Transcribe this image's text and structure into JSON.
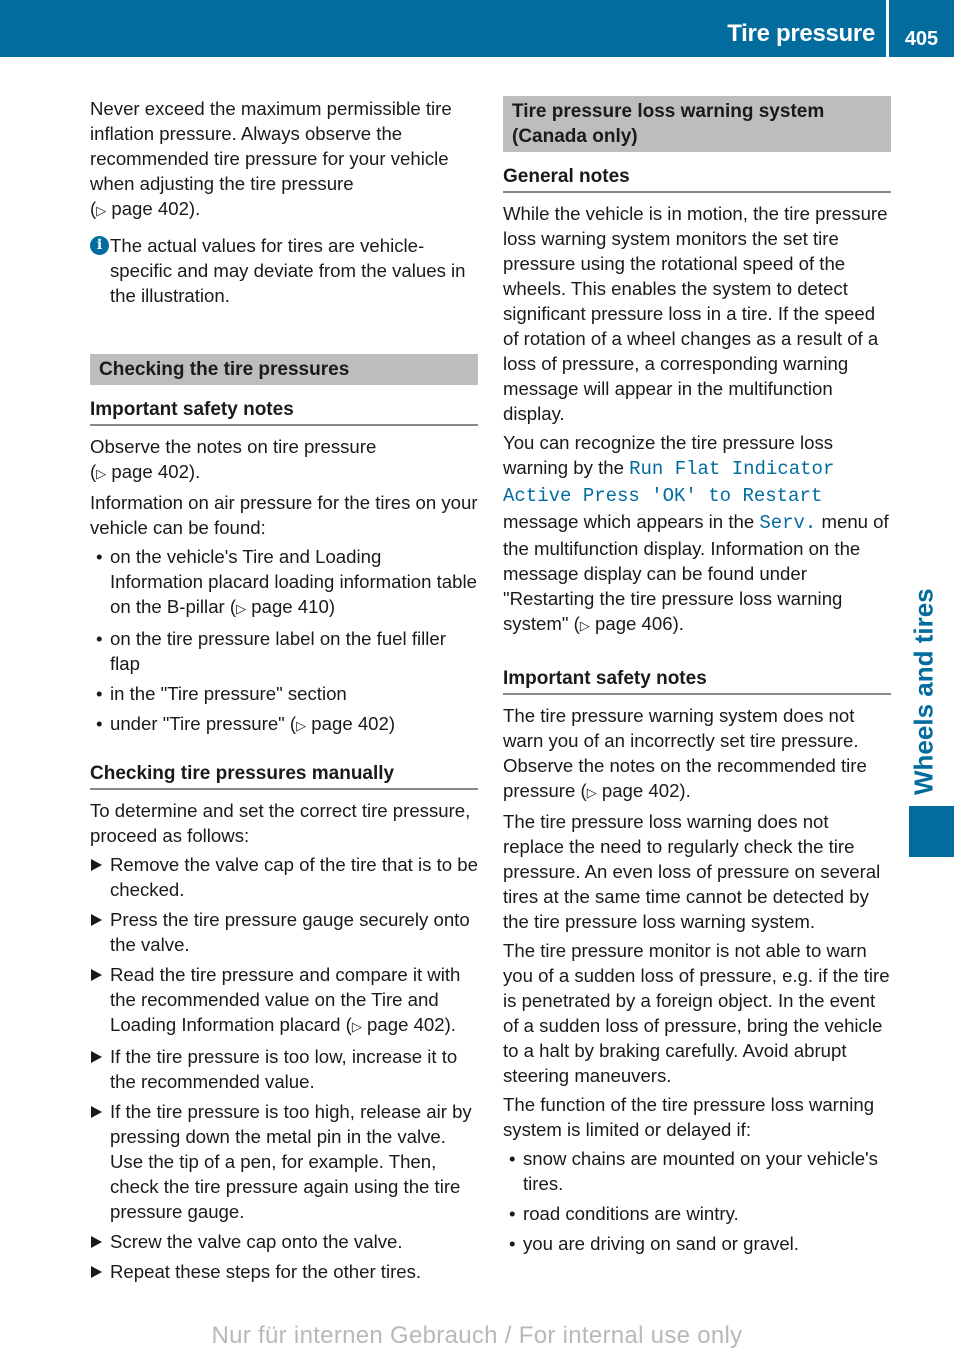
{
  "header": {
    "title": "Tire pressure",
    "page_number": "405"
  },
  "side_tab": {
    "label": "Wheels and tires"
  },
  "colors": {
    "accent": "#036c9f",
    "banner_gray": "#bdbdbd"
  },
  "left": {
    "intro": "Never exceed the maximum permissible tire inflation pressure. Always observe the recommended tire pressure for your vehicle when adjusting the tire pressure",
    "intro_ref": "page 402).",
    "info_note": "The actual values for tires are vehicle-specific and may deviate from the values in the illustration.",
    "section_title": "Checking the tire pressures",
    "safety_heading": "Important safety notes",
    "safety_p1": "Observe the notes on tire pressure",
    "safety_p1_ref": "page 402).",
    "safety_p2": "Information on air pressure for the tires on your vehicle can be found:",
    "locations": [
      {
        "text": "on the vehicle's Tire and Loading Information placard loading information table on the B-pillar (",
        "ref": "page 410)"
      },
      {
        "text": "on the tire pressure label on the fuel filler flap",
        "ref": ""
      },
      {
        "text": "in the \"Tire pressure\" section",
        "ref": ""
      },
      {
        "text": "under \"Tire pressure\" (",
        "ref": "page 402)"
      }
    ],
    "manual_heading": "Checking tire pressures manually",
    "manual_intro": "To determine and set the correct tire pressure, proceed as follows:",
    "steps": [
      {
        "text": "Remove the valve cap of the tire that is to be checked.",
        "ref": ""
      },
      {
        "text": "Press the tire pressure gauge securely onto the valve.",
        "ref": ""
      },
      {
        "text": "Read the tire pressure and compare it with the recommended value on the Tire and Loading Information placard (",
        "ref": "page 402)."
      },
      {
        "text": "If the tire pressure is too low, increase it to the recommended value.",
        "ref": ""
      },
      {
        "text": "If the tire pressure is too high, release air by pressing down the metal pin in the valve. Use the tip of a pen, for example. Then, check the tire pressure again using the tire pressure gauge.",
        "ref": ""
      },
      {
        "text": "Screw the valve cap onto the valve.",
        "ref": ""
      },
      {
        "text": "Repeat these steps for the other tires.",
        "ref": ""
      }
    ]
  },
  "right": {
    "section_title": "Tire pressure loss warning system (Canada only)",
    "general_heading": "General notes",
    "general_p1": "While the vehicle is in motion, the tire pressure loss warning system monitors the set tire pressure using the rotational speed of the wheels. This enables the system to detect significant pressure loss in a tire. If the speed of rotation of a wheel changes as a result of a loss of pressure, a corresponding warning message will appear in the multifunction display.",
    "general_p2_a": "You can recognize the tire pressure loss warning by the ",
    "display_message": "Run Flat Indicator Active Press 'OK' to Restart",
    "general_p2_b": " message which appears in the ",
    "menu_name": "Serv.",
    "general_p2_c": " menu of the multifunction display. Information on the message display can be found under \"Restarting the tire pressure loss warning system\" (",
    "general_p2_ref": "page 406).",
    "safety_heading": "Important safety notes",
    "safety_p1": "The tire pressure warning system does not warn you of an incorrectly set tire pressure. Observe the notes on the recommended tire pressure (",
    "safety_p1_ref": "page 402).",
    "safety_p2": "The tire pressure loss warning does not replace the need to regularly check the tire pressure. An even loss of pressure on several tires at the same time cannot be detected by the tire pressure loss warning system.",
    "safety_p3": "The tire pressure monitor is not able to warn you of a sudden loss of pressure, e.g. if the tire is penetrated by a foreign object. In the event of a sudden loss of pressure, bring the vehicle to a halt by braking carefully. Avoid abrupt steering maneuvers.",
    "safety_p4": "The function of the tire pressure loss warning system is limited or delayed if:",
    "conditions": [
      "snow chains are mounted on your vehicle's tires.",
      "road conditions are wintry.",
      "you are driving on sand or gravel."
    ]
  },
  "footer": {
    "watermark": "Nur für internen Gebrauch / For internal use only"
  },
  "glyphs": {
    "page_ref": "▷",
    "info": "i"
  }
}
